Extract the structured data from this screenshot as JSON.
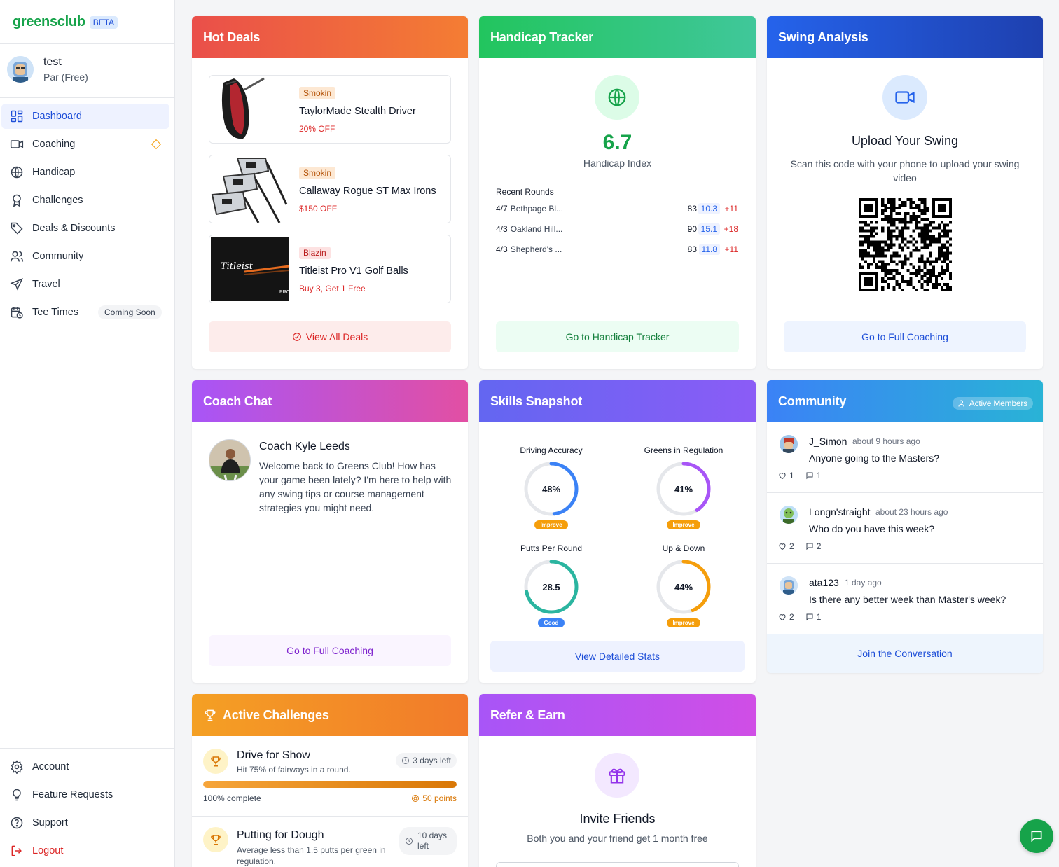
{
  "brand": {
    "name": "greensclub",
    "badge": "BETA"
  },
  "user": {
    "name": "test",
    "plan": "Par (Free)"
  },
  "nav": [
    {
      "label": "Dashboard",
      "icon": "dashboard-icon"
    },
    {
      "label": "Coaching",
      "icon": "video-icon"
    },
    {
      "label": "Handicap",
      "icon": "globe-icon"
    },
    {
      "label": "Challenges",
      "icon": "award-icon"
    },
    {
      "label": "Deals & Discounts",
      "icon": "tag-icon"
    },
    {
      "label": "Community",
      "icon": "users-icon"
    },
    {
      "label": "Travel",
      "icon": "plane-icon"
    },
    {
      "label": "Tee Times",
      "icon": "calendar-clock-icon",
      "badge": "Coming Soon"
    }
  ],
  "nav_bottom": [
    {
      "label": "Account",
      "icon": "gear-icon"
    },
    {
      "label": "Feature Requests",
      "icon": "lightbulb-icon"
    },
    {
      "label": "Support",
      "icon": "help-circle-icon"
    },
    {
      "label": "Logout",
      "icon": "logout-icon"
    }
  ],
  "hot_deals": {
    "title": "Hot Deals",
    "deals": [
      {
        "tag": "Smokin",
        "title": "TaylorMade Stealth Driver",
        "offer": "20% OFF"
      },
      {
        "tag": "Smokin",
        "title": "Callaway Rogue ST Max Irons",
        "offer": "$150 OFF"
      },
      {
        "tag": "Blazin",
        "title": "Titleist Pro V1 Golf Balls",
        "offer": "Buy 3, Get 1 Free"
      }
    ],
    "button": "View All Deals",
    "ball_brand": "Titleist",
    "ball_box_text": "PRO"
  },
  "handicap": {
    "title": "Handicap Tracker",
    "index": "6.7",
    "index_label": "Handicap Index",
    "recent_label": "Recent Rounds",
    "rounds": [
      {
        "date": "4/7",
        "course": "Bethpage Bl...",
        "score": "83",
        "hcp": "10.3",
        "diff": "+11"
      },
      {
        "date": "4/3",
        "course": "Oakland Hill...",
        "score": "90",
        "hcp": "15.1",
        "diff": "+18"
      },
      {
        "date": "4/3",
        "course": "Shepherd's ...",
        "score": "83",
        "hcp": "11.8",
        "diff": "+11"
      }
    ],
    "button": "Go to Handicap Tracker"
  },
  "swing": {
    "title": "Swing Analysis",
    "heading": "Upload Your Swing",
    "description": "Scan this code with your phone to upload your swing video",
    "button": "Go to Full Coaching"
  },
  "coach_chat": {
    "title": "Coach Chat",
    "coach_name": "Coach Kyle Leeds",
    "message": "Welcome back to Greens Club! How has your game been lately? I'm here to help with any swing tips or course management strategies you might need.",
    "button": "Go to Full Coaching"
  },
  "skills": {
    "title": "Skills Snapshot",
    "stats": [
      {
        "label": "Driving Accuracy",
        "value": "48%",
        "fraction": 0.48,
        "status": "Improve",
        "color": "#3b82f6"
      },
      {
        "label": "Greens in Regulation",
        "value": "41%",
        "fraction": 0.41,
        "status": "Improve",
        "color": "#a855f7"
      },
      {
        "label": "Putts Per Round",
        "value": "28.5",
        "fraction": 0.72,
        "status": "Good",
        "color": "#2bb5a0"
      },
      {
        "label": "Up & Down",
        "value": "44%",
        "fraction": 0.44,
        "status": "Improve",
        "color": "#f59e0b"
      }
    ],
    "button": "View Detailed Stats"
  },
  "community": {
    "title": "Community",
    "badge": "Active Members",
    "posts": [
      {
        "user": "J_Simon",
        "time": "about 9 hours ago",
        "text": "Anyone going to the Masters?",
        "likes": "1",
        "comments": "1"
      },
      {
        "user": "Longn'straight",
        "time": "about 23 hours ago",
        "text": "Who do you have this week?",
        "likes": "2",
        "comments": "2"
      },
      {
        "user": "ata123",
        "time": "1 day ago",
        "text": "Is there any better week than Master's week?",
        "likes": "2",
        "comments": "1"
      }
    ],
    "button": "Join the Conversation"
  },
  "challenges": {
    "title": "Active Challenges",
    "items": [
      {
        "name": "Drive for Show",
        "desc": "Hit 75% of fairways in a round.",
        "time_left": "3 days left",
        "progress": 1.0,
        "progress_text": "100% complete",
        "points": "50 points"
      },
      {
        "name": "Putting for Dough",
        "desc": "Average less than 1.5 putts per green in regulation.",
        "time_left": "10 days left"
      }
    ]
  },
  "refer": {
    "title": "Refer & Earn",
    "heading": "Invite Friends",
    "description": "Both you and your friend get 1 month free"
  }
}
